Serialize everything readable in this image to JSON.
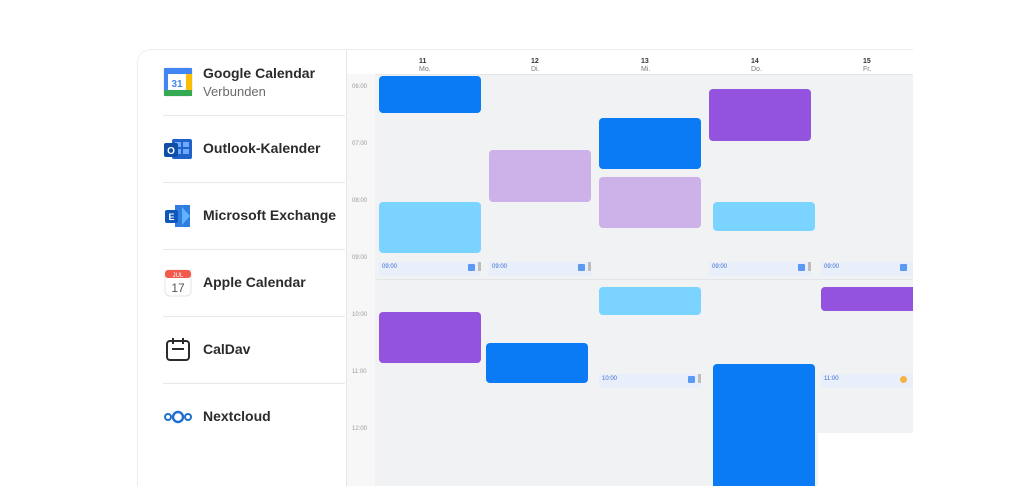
{
  "sidebar": {
    "items": [
      {
        "label": "Google Calendar",
        "sub": "Verbunden",
        "icon": "google-calendar-icon"
      },
      {
        "label": "Outlook-Kalender",
        "icon": "outlook-icon"
      },
      {
        "label": "Microsoft Exchange",
        "icon": "exchange-icon"
      },
      {
        "label": "Apple Calendar",
        "icon": "apple-calendar-icon",
        "icon_text": {
          "month": "JUL",
          "day": "17"
        }
      },
      {
        "label": "CalDav",
        "icon": "caldav-icon"
      },
      {
        "label": "Nextcloud",
        "icon": "nextcloud-icon"
      }
    ]
  },
  "calendar": {
    "days": [
      {
        "prefix": "Mo.",
        "num": "11"
      },
      {
        "prefix": "Di.",
        "num": "12"
      },
      {
        "prefix": "Mi.",
        "num": "13"
      },
      {
        "prefix": "Do.",
        "num": "14"
      },
      {
        "prefix": "Fr.",
        "num": "15"
      }
    ],
    "hours": [
      "06:00",
      "07:00",
      "08:00",
      "09:00",
      "10:00",
      "11:00",
      "12:00"
    ],
    "strip_times": [
      "09:00",
      "09:00",
      "09:00",
      "09:00",
      "10:00",
      "11:00"
    ]
  },
  "colors": {
    "blue": "#0a7af5",
    "light_blue": "#7bd4ff",
    "purple": "#9353df",
    "light_purple": "#cdb1e9"
  }
}
